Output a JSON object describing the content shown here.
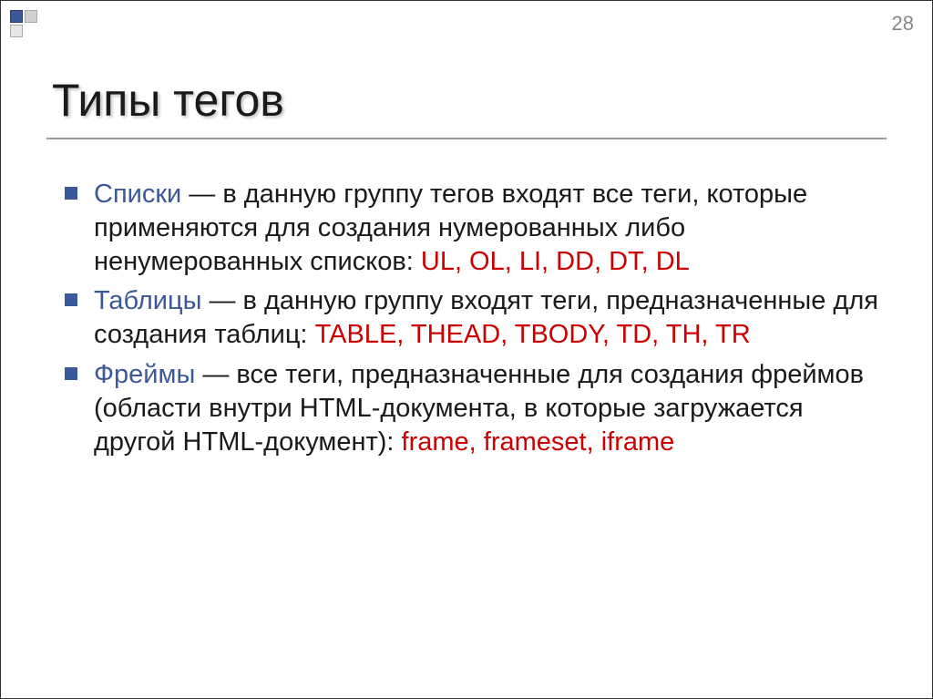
{
  "page_number": "28",
  "title": "Типы тегов",
  "items": [
    {
      "term": "Списки",
      "body_before": " — в данную группу тегов входят все теги, которые применяются для создания нумерованных либо ненумерованных списков: ",
      "tags": "UL, OL, LI, DD, DT, DL",
      "body_after": ""
    },
    {
      "term": "Таблицы",
      "body_before": " — в данную группу входят теги, предназначенные для создания таблиц: ",
      "tags": "TABLE, THEAD, TBODY, TD, TH, TR",
      "body_after": ""
    },
    {
      "term": "Фреймы",
      "body_before": " — все теги, предназначенные для создания фреймов (области внутри HTML-документа, в которые загружается другой HTML-документ): ",
      "tags": "frame, frameset, iframe",
      "body_after": ""
    }
  ]
}
